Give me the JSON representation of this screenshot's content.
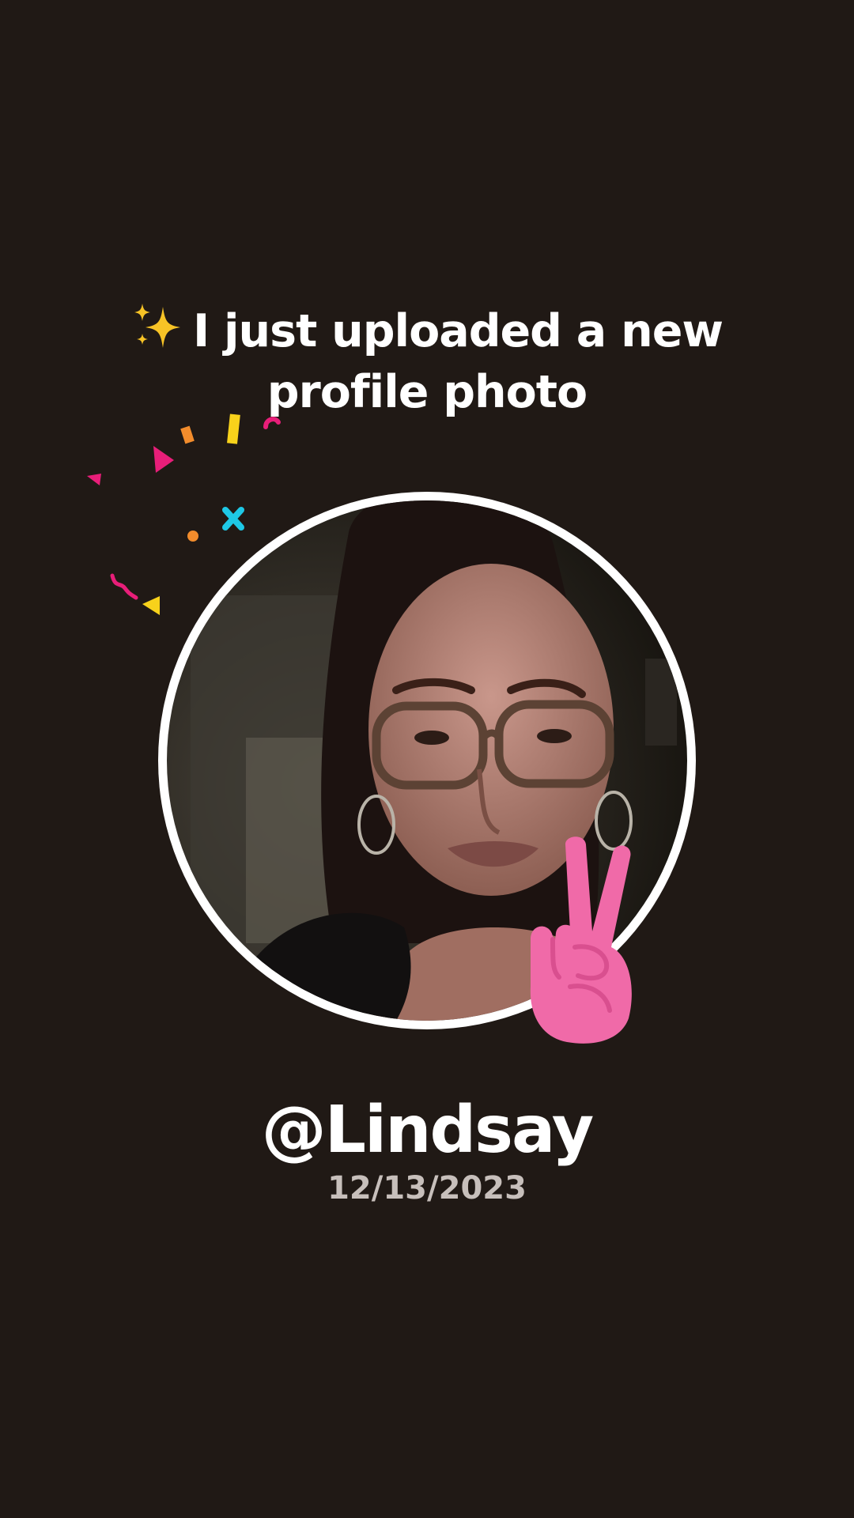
{
  "headline": {
    "sparkle_icon": "sparkles-icon",
    "line1": "I just uploaded a new",
    "line2": "profile photo"
  },
  "profile": {
    "username": "@Lindsay",
    "date": "12/13/2023",
    "photo_icon": "profile-photo",
    "sticker_icon": "victory-hand-icon"
  },
  "colors": {
    "background": "#201915",
    "ring": "#ffffff",
    "date_text": "#c7bfbb",
    "sticker": "#f06aa8",
    "confetti_pink": "#e81e79",
    "confetti_yellow": "#f8d21b",
    "confetti_cyan": "#1ec8e6",
    "confetti_orange": "#f28c2c"
  }
}
